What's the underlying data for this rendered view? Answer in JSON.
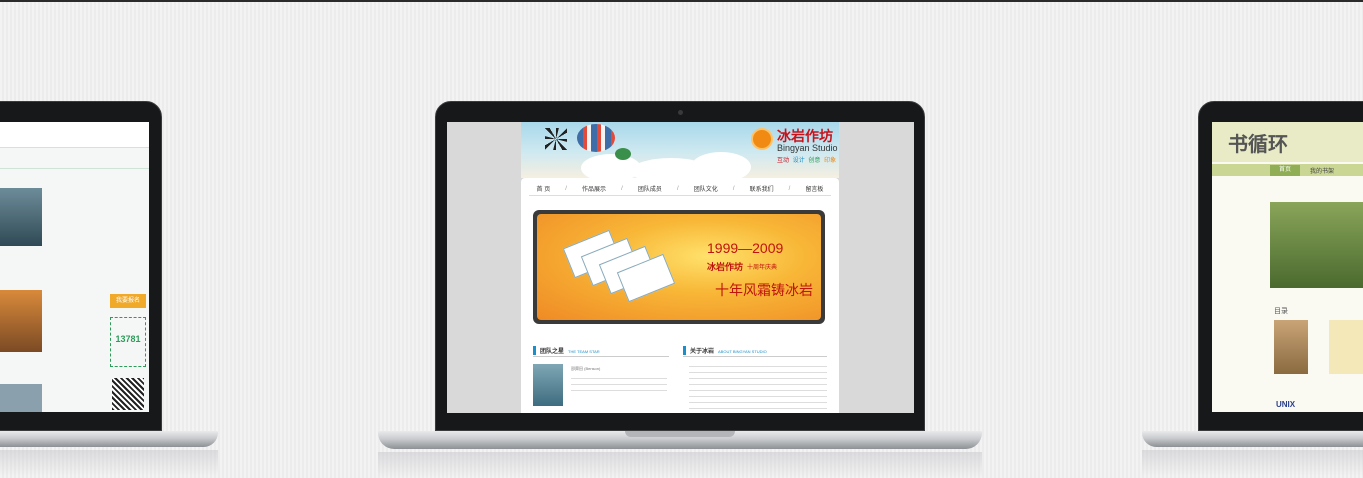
{
  "center_site": {
    "brand": {
      "name": "冰岩作坊",
      "en": "Bingyan Studio",
      "tag": [
        "互动",
        "设计",
        "创意",
        "印象"
      ]
    },
    "nav": [
      "首 页",
      "作品展示",
      "团队成员",
      "团队文化",
      "联系我们",
      "留言板"
    ],
    "banner": {
      "years": "1999—2009",
      "brand": "冰岩作坊",
      "anniversary": "十周年庆典",
      "slogan": "十年风霜铸冰岩"
    },
    "team_star": {
      "title": "团队之星",
      "en": "THE TEAM STAR",
      "name": "邵舜田 (Benson)"
    },
    "about": {
      "title": "关于冰岩",
      "en": "ABOUT BINGYAN STUDIO"
    }
  },
  "left_site": {
    "badge_count": "13781",
    "button": "我要报名"
  },
  "right_site": {
    "title": "书循环",
    "tabs": [
      "首页",
      "我的书架"
    ],
    "section": "目录",
    "book": "UNIX"
  },
  "colors": {
    "accent": "#1a8fc9",
    "brand_red": "#c8121a",
    "orange": "#f08a12"
  }
}
